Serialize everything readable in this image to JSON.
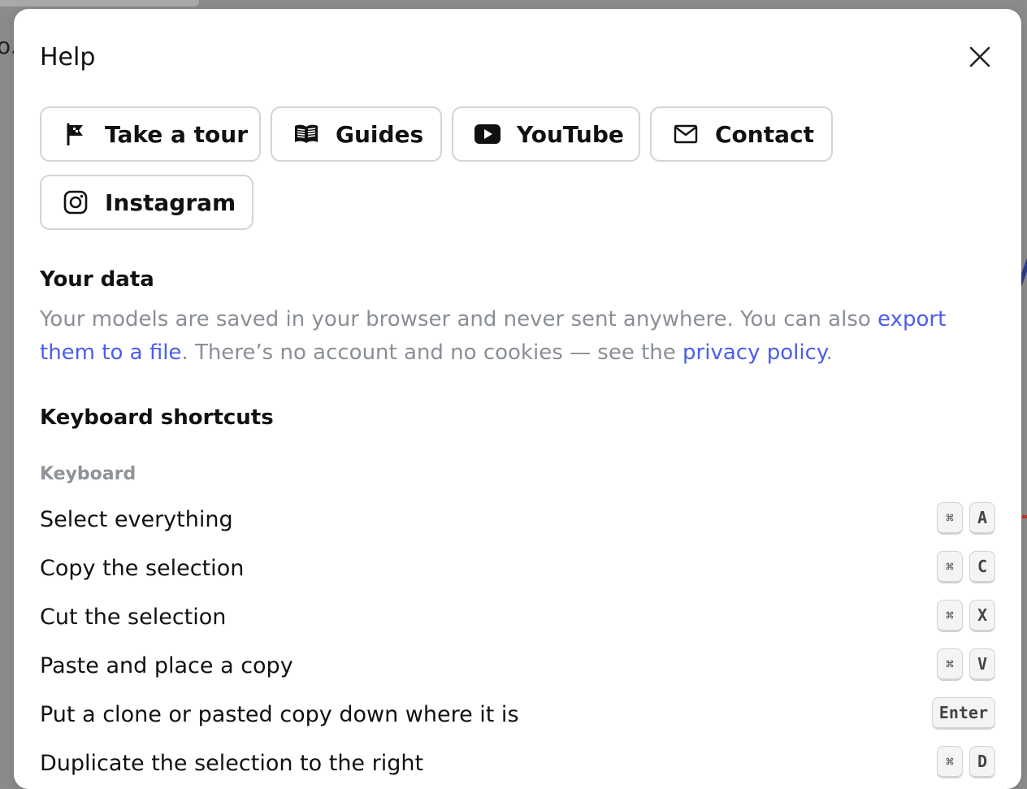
{
  "backdrop": {
    "fragment_text": "o."
  },
  "dialog": {
    "title": "Help",
    "close_icon": "close-x-icon"
  },
  "help_links": [
    {
      "label": "Take a tour",
      "icon": "flag-icon"
    },
    {
      "label": "Guides",
      "icon": "book-icon"
    },
    {
      "label": "YouTube",
      "icon": "youtube-icon"
    },
    {
      "label": "Contact",
      "icon": "mail-icon"
    },
    {
      "label": "Instagram",
      "icon": "instagram-icon"
    }
  ],
  "your_data": {
    "heading": "Your data",
    "text_1": "Your models are saved in your browser and never sent anywhere. You can also ",
    "link_export": "export them to a file",
    "text_2": ". There’s no account and no cookies — see the ",
    "link_privacy": "privacy policy",
    "text_3": "."
  },
  "shortcuts": {
    "heading": "Keyboard shortcuts",
    "group_label": "Keyboard",
    "items": [
      {
        "label": "Select everything",
        "keys": [
          "⌘",
          "A"
        ]
      },
      {
        "label": "Copy the selection",
        "keys": [
          "⌘",
          "C"
        ]
      },
      {
        "label": "Cut the selection",
        "keys": [
          "⌘",
          "X"
        ]
      },
      {
        "label": "Paste and place a copy",
        "keys": [
          "⌘",
          "V"
        ]
      },
      {
        "label": "Put a clone or pasted copy down where it is",
        "keys": [
          "Enter"
        ]
      },
      {
        "label": "Duplicate the selection to the right",
        "keys": [
          "⌘",
          "D"
        ]
      }
    ]
  },
  "colors": {
    "link": "#4a5ee8",
    "muted_text": "#8a8f96",
    "border": "#d4d4d4"
  }
}
